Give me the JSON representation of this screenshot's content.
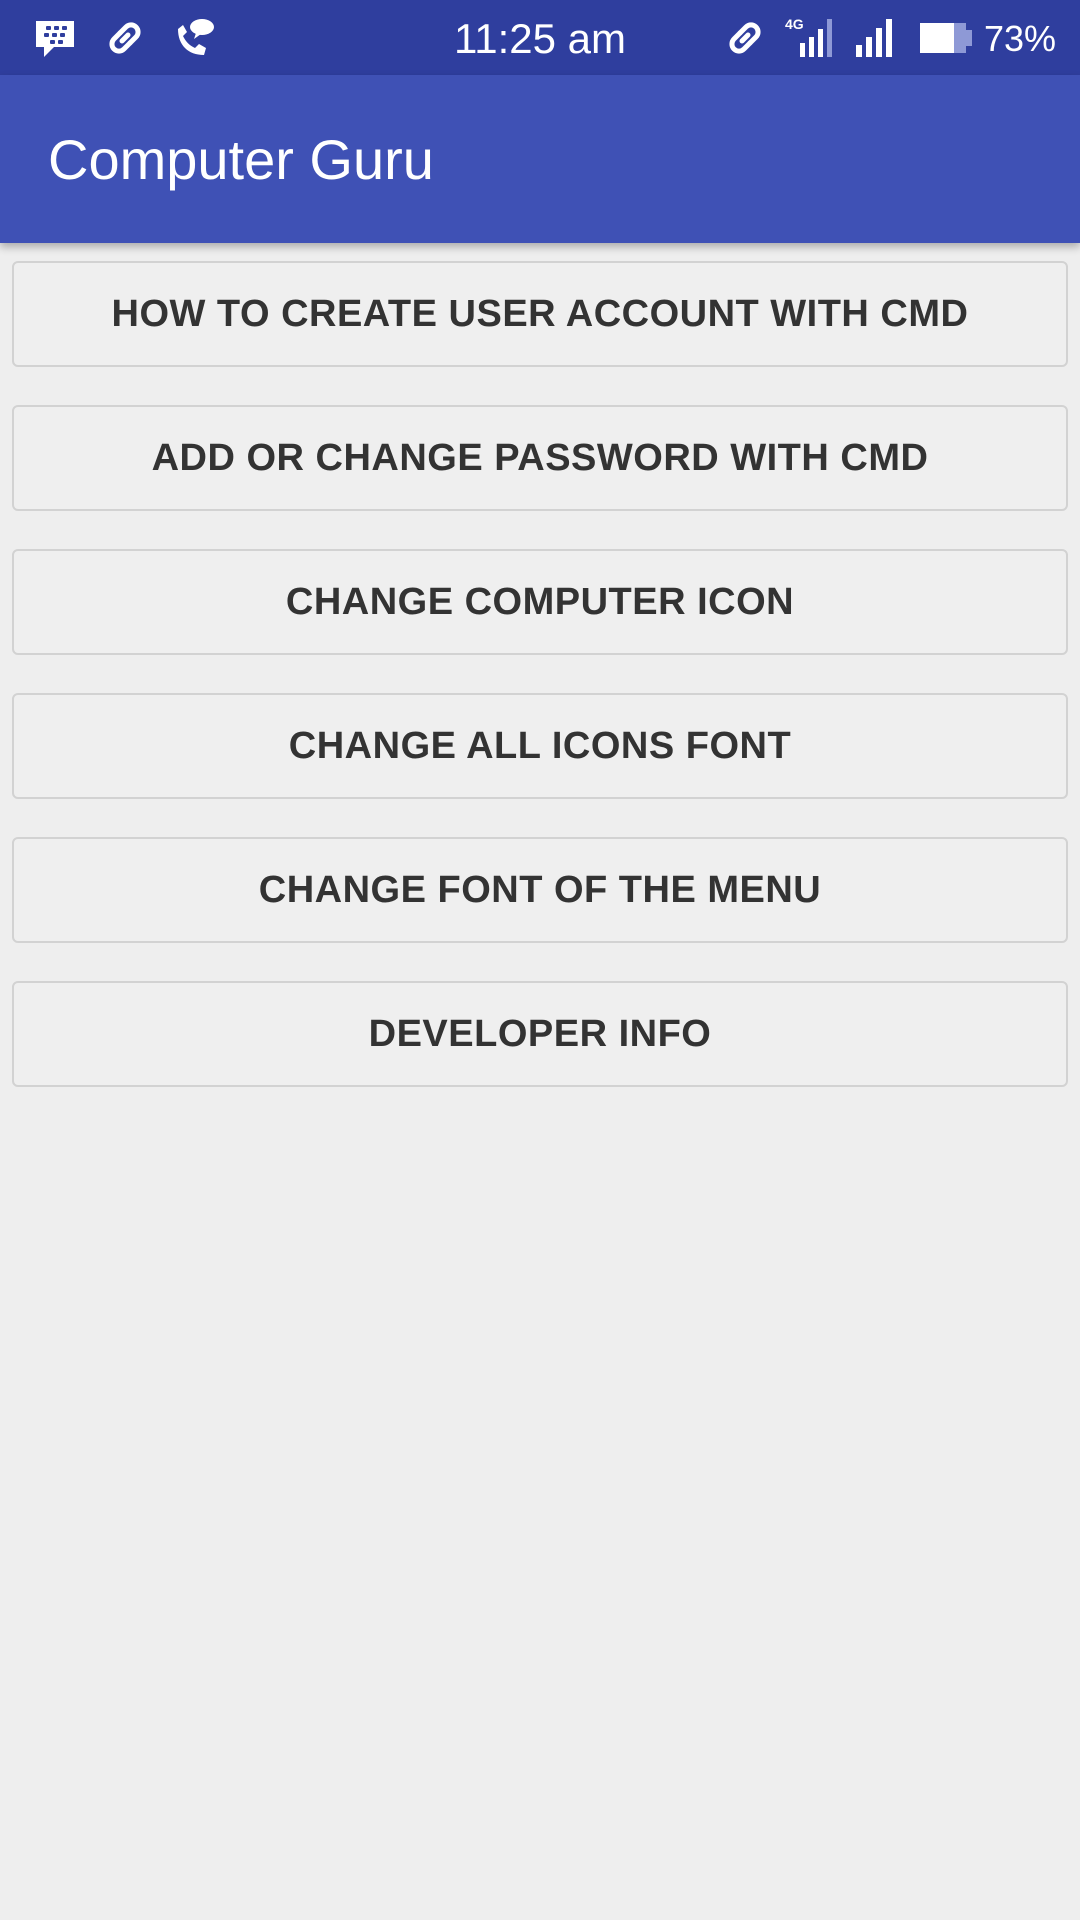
{
  "status_bar": {
    "time": "11:25 am",
    "battery_percent": "73%",
    "network_type": "4G",
    "icons": [
      "bbm-icon",
      "link-icon",
      "wifi-call-icon",
      "link-icon",
      "signal-4g-icon",
      "signal-icon",
      "battery-icon"
    ]
  },
  "app_bar": {
    "title": "Computer Guru",
    "color": "#3f51b5"
  },
  "menu": {
    "items": [
      {
        "label": "HOW TO CREATE USER ACCOUNT WITH CMD"
      },
      {
        "label": "ADD OR CHANGE PASSWORD WITH CMD"
      },
      {
        "label": "CHANGE COMPUTER ICON"
      },
      {
        "label": "CHANGE ALL ICONS FONT"
      },
      {
        "label": "CHANGE FONT OF THE MENU"
      },
      {
        "label": "DEVELOPER INFO"
      }
    ]
  }
}
